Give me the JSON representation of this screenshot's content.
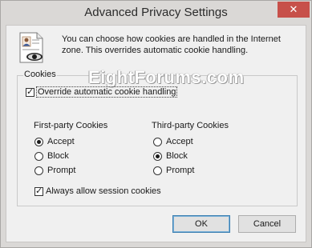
{
  "window": {
    "title": "Advanced Privacy Settings",
    "close_glyph": "✕"
  },
  "header": {
    "icon": "document-eye-icon",
    "intro_text": "You can choose how cookies are handled in the Internet zone.  This overrides automatic cookie handling."
  },
  "watermark": "EightForums.com",
  "cookies_group": {
    "legend": "Cookies",
    "override": {
      "label": "Override automatic cookie handling",
      "checked": true
    },
    "first_party": {
      "title": "First-party Cookies",
      "options": [
        {
          "label": "Accept",
          "selected": true
        },
        {
          "label": "Block",
          "selected": false
        },
        {
          "label": "Prompt",
          "selected": false
        }
      ]
    },
    "third_party": {
      "title": "Third-party Cookies",
      "options": [
        {
          "label": "Accept",
          "selected": false
        },
        {
          "label": "Block",
          "selected": true
        },
        {
          "label": "Prompt",
          "selected": false
        }
      ]
    },
    "session": {
      "label": "Always allow session cookies",
      "checked": true
    }
  },
  "buttons": {
    "ok": "OK",
    "cancel": "Cancel"
  },
  "colors": {
    "close_button": "#c7504a",
    "default_button_border": "#3c7fb1"
  }
}
